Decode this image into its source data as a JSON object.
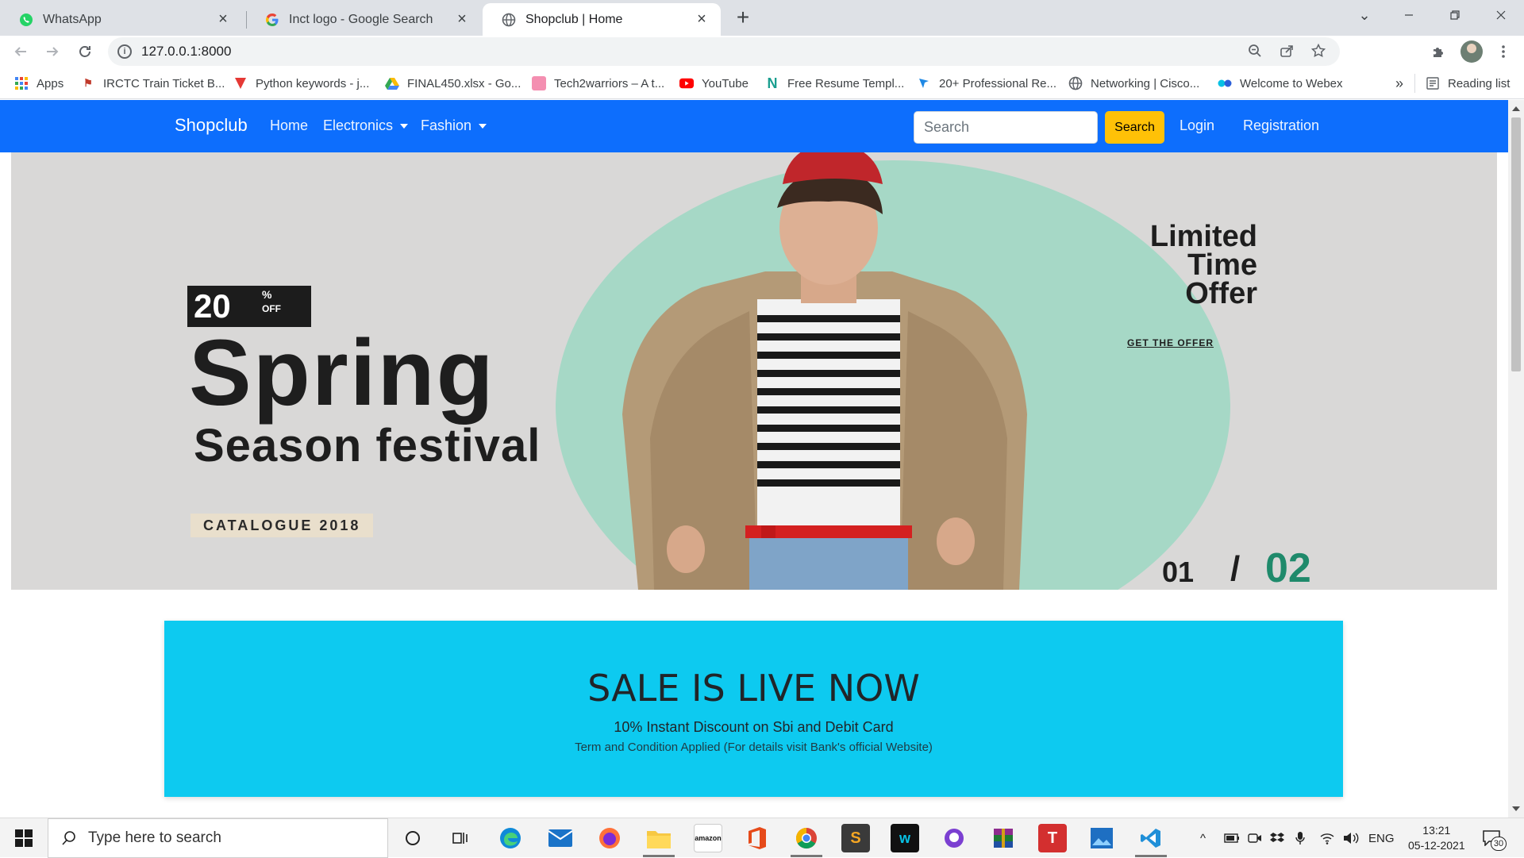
{
  "browser": {
    "tabs": [
      {
        "title": "WhatsApp",
        "icon": "whatsapp-icon"
      },
      {
        "title": "Inct logo - Google Search",
        "icon": "google-icon"
      },
      {
        "title": "Shopclub | Home",
        "icon": "globe-icon"
      }
    ],
    "url": "127.0.0.1:8000",
    "bookmarks": [
      {
        "label": "Apps",
        "icon": "apps-grid-icon"
      },
      {
        "label": "IRCTC Train Ticket B...",
        "icon": "irctc-icon"
      },
      {
        "label": "Python keywords - j...",
        "icon": "javatpoint-icon"
      },
      {
        "label": "FINAL450.xlsx - Go...",
        "icon": "google-drive-icon"
      },
      {
        "label": "Tech2warriors – A t...",
        "icon": "tech2warriors-icon"
      },
      {
        "label": "YouTube",
        "icon": "youtube-icon"
      },
      {
        "label": "Free Resume Templ...",
        "icon": "novoresume-icon"
      },
      {
        "label": "20+ Professional Re...",
        "icon": "bookmark-site-icon"
      },
      {
        "label": "Networking | Cisco...",
        "icon": "globe-icon"
      },
      {
        "label": "Welcome to Webex",
        "icon": "webex-icon"
      }
    ],
    "more_bookmarks": "»",
    "reading_list": "Reading list"
  },
  "site": {
    "brand": "Shopclub",
    "nav": {
      "home": "Home",
      "electronics": "Electronics",
      "fashion": "Fashion"
    },
    "search_placeholder": "Search",
    "search_button": "Search",
    "login": "Login",
    "registration": "Registration"
  },
  "hero": {
    "discount": "20",
    "discount_pct": "%",
    "discount_off": "OFF",
    "headline": "Spring",
    "subheadline": "Season festival",
    "catalogue": "CATALOGUE 2018",
    "offer_line1": "Limited",
    "offer_line2": "Time",
    "offer_line3": "Offer",
    "get_offer": "GET THE OFFER",
    "slide_current": "01",
    "slide_separator": "/",
    "slide_total": "02"
  },
  "sale": {
    "title": "SALE IS LIVE NOW",
    "line1": "10% Instant Discount on Sbi and Debit Card",
    "line2": "Term and Condition Applied (For details visit Bank's official Website)"
  },
  "taskbar": {
    "search_placeholder": "Type here to search",
    "language": "ENG",
    "time": "13:21",
    "date": "05-12-2021",
    "notifications": "30"
  },
  "colors": {
    "navbar": "#0d6efd",
    "search_button": "#ffc107",
    "sale_background": "#0dcaf0"
  }
}
